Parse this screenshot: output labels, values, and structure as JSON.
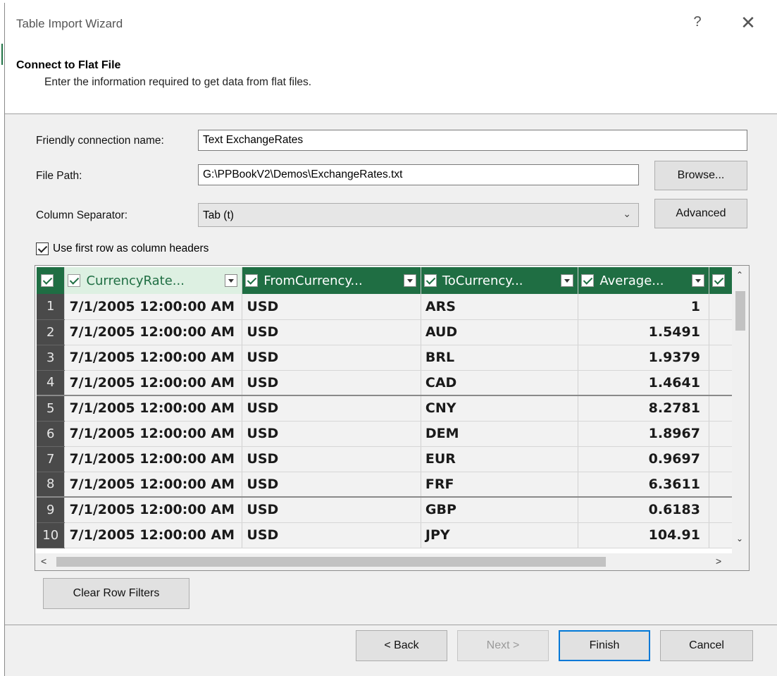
{
  "window": {
    "title": "Table Import Wizard",
    "help_glyph": "?",
    "close_glyph": "✕"
  },
  "header": {
    "title": "Connect to Flat File",
    "subtitle": "Enter the information required to get data from flat files."
  },
  "form": {
    "friendly_name_label": "Friendly connection name:",
    "friendly_name_value": "Text ExchangeRates",
    "file_path_label": "File Path:",
    "file_path_value": "G:\\PPBookV2\\Demos\\ExchangeRates.txt",
    "browse_label": "Browse...",
    "separator_label": "Column Separator:",
    "separator_value": "Tab (t)",
    "advanced_label": "Advanced",
    "first_row_header_label": "Use first row as column headers",
    "first_row_header_checked": true
  },
  "grid": {
    "columns": [
      "CurrencyRate...",
      "FromCurrency...",
      "ToCurrency...",
      "Average..."
    ],
    "rows": [
      {
        "n": "1",
        "date": "7/1/2005 12:00:00 AM",
        "from": "USD",
        "to": "ARS",
        "avg": "1"
      },
      {
        "n": "2",
        "date": "7/1/2005 12:00:00 AM",
        "from": "USD",
        "to": "AUD",
        "avg": "1.5491"
      },
      {
        "n": "3",
        "date": "7/1/2005 12:00:00 AM",
        "from": "USD",
        "to": "BRL",
        "avg": "1.9379"
      },
      {
        "n": "4",
        "date": "7/1/2005 12:00:00 AM",
        "from": "USD",
        "to": "CAD",
        "avg": "1.4641"
      },
      {
        "n": "5",
        "date": "7/1/2005 12:00:00 AM",
        "from": "USD",
        "to": "CNY",
        "avg": "8.2781"
      },
      {
        "n": "6",
        "date": "7/1/2005 12:00:00 AM",
        "from": "USD",
        "to": "DEM",
        "avg": "1.8967"
      },
      {
        "n": "7",
        "date": "7/1/2005 12:00:00 AM",
        "from": "USD",
        "to": "EUR",
        "avg": "0.9697"
      },
      {
        "n": "8",
        "date": "7/1/2005 12:00:00 AM",
        "from": "USD",
        "to": "FRF",
        "avg": "6.3611"
      },
      {
        "n": "9",
        "date": "7/1/2005 12:00:00 AM",
        "from": "USD",
        "to": "GBP",
        "avg": "0.6183"
      },
      {
        "n": "10",
        "date": "7/1/2005 12:00:00 AM",
        "from": "USD",
        "to": "JPY",
        "avg": "104.91"
      }
    ]
  },
  "buttons": {
    "clear_filters": "Clear Row Filters",
    "back": "< Back",
    "next": "Next >",
    "finish": "Finish",
    "cancel": "Cancel"
  },
  "colors": {
    "grid_header": "#1f6e43",
    "default_button_border": "#0078d7"
  }
}
